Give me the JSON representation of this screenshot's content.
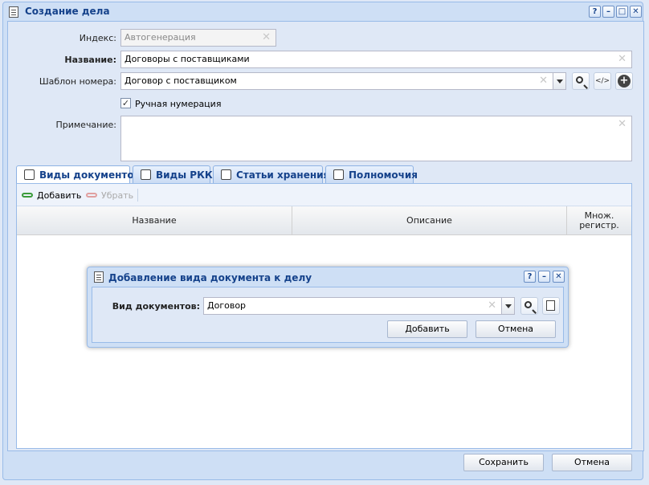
{
  "window": {
    "title": "Создание дела",
    "tools": [
      "?",
      "–",
      "□",
      "✕"
    ]
  },
  "form": {
    "index": {
      "label": "Индекс:",
      "placeholder": "Автогенерация"
    },
    "name": {
      "label": "Название:",
      "value": "Договоры с поставщиками"
    },
    "template": {
      "label": "Шаблон номера:",
      "value": "Договор с поставщиком",
      "code_icon": "</>"
    },
    "manual": {
      "label": "Ручная нумерация",
      "checked": true
    },
    "note": {
      "label": "Примечание:",
      "value": ""
    }
  },
  "tabs": [
    {
      "label": "Виды документов",
      "active": true
    },
    {
      "label": "Виды РКК",
      "active": false
    },
    {
      "label": "Статьи хранения",
      "active": false
    },
    {
      "label": "Полномочия",
      "active": false
    }
  ],
  "panel_toolbar": {
    "add": "Добавить",
    "remove": "Убрать"
  },
  "grid": {
    "columns": [
      "Название",
      "Описание",
      "Множ.\nрегистр."
    ]
  },
  "dialog": {
    "title": "Добавление вида документа к делу",
    "tools": [
      "?",
      "–",
      "✕"
    ],
    "field_label": "Вид документов:",
    "field_value": "Договор",
    "add_button": "Добавить",
    "cancel_button": "Отмена"
  },
  "footer": {
    "save": "Сохранить",
    "cancel": "Отмена"
  },
  "colors": {
    "title": "#15428b",
    "border": "#99bbe8",
    "frame": "#cedff5"
  }
}
